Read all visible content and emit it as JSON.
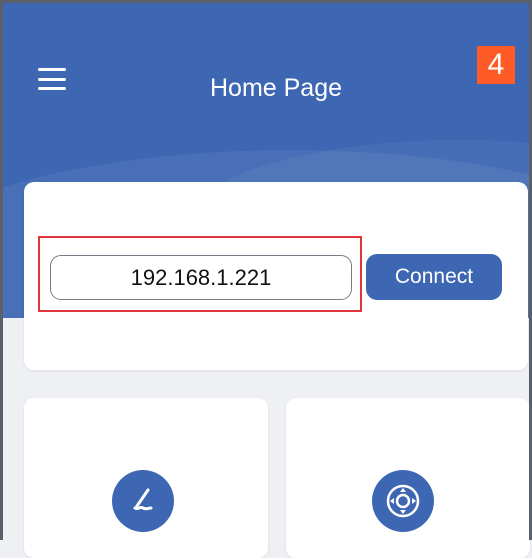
{
  "header": {
    "title": "Home Page",
    "badge": "4",
    "background_color": "#3d67b3",
    "menu_icon": "hamburger-menu-icon"
  },
  "connection": {
    "ip_value": "192.168.1.221",
    "connect_label": "Connect",
    "highlight_color": "#e1353b"
  },
  "tiles": [
    {
      "icon": "pen-draw-icon"
    },
    {
      "icon": "joystick-control-icon"
    }
  ]
}
